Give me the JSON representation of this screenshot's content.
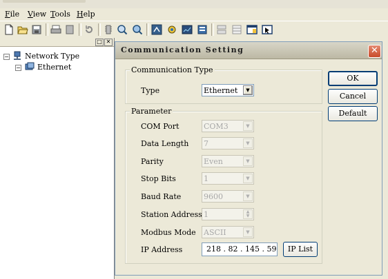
{
  "menu": [
    "File",
    "View",
    "Tools",
    "Help"
  ],
  "menu_accel": [
    "F",
    "V",
    "T",
    "H"
  ],
  "toolbar_icons": [
    "new-icon",
    "open-icon",
    "save-icon",
    "print-icon",
    "print-preview-icon",
    "refresh-icon",
    "settings-icon",
    "zoom-in-icon",
    "zoom-out-icon",
    "connect-icon",
    "monitor-icon",
    "trend-icon",
    "report-icon",
    "tile-icon",
    "cascade-icon",
    "window-icon",
    "pointer-icon"
  ],
  "tree": {
    "root": "Network Type",
    "child": "Ethernet",
    "root_expander": "−",
    "child_expander": "−",
    "header_buttons": [
      "□",
      "✕"
    ]
  },
  "dialog": {
    "title": "Communication Setting",
    "close_symbol": "✕",
    "comm_type": {
      "group_label": "Communication Type",
      "type_label": "Type",
      "type_value": "Ethernet"
    },
    "parameter": {
      "group_label": "Parameter",
      "fields": [
        {
          "label": "COM Port",
          "value": "COM3"
        },
        {
          "label": "Data Length",
          "value": "7"
        },
        {
          "label": "Parity",
          "value": "Even"
        },
        {
          "label": "Stop Bits",
          "value": "1"
        },
        {
          "label": "Baud Rate",
          "value": "9600"
        },
        {
          "label": "Station Address",
          "value": "1"
        },
        {
          "label": "Modbus Mode",
          "value": "ASCII"
        }
      ],
      "ip_label": "IP Address",
      "ip_value": "218 . 82 . 145 . 59",
      "ip_list_button": "IP List"
    },
    "buttons": {
      "ok": "OK",
      "cancel": "Cancel",
      "default": "Default"
    }
  }
}
